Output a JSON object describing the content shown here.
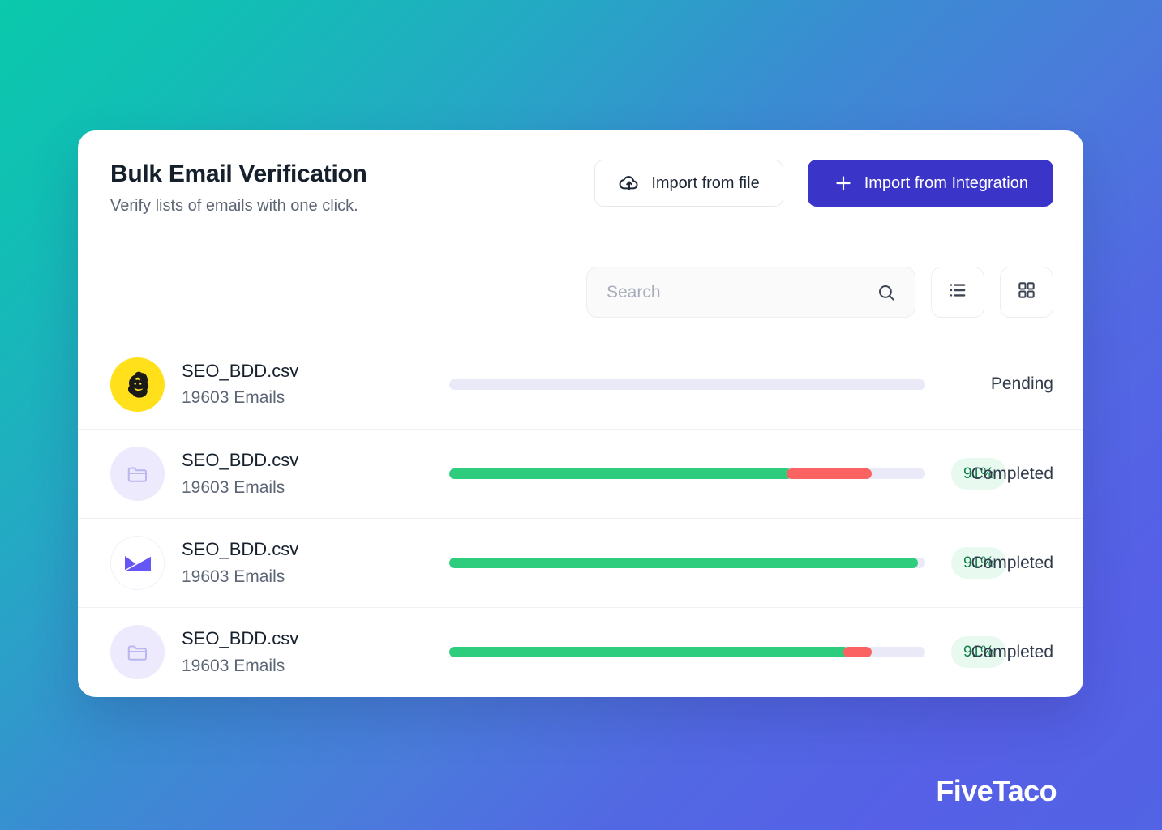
{
  "header": {
    "title": "Bulk Email Verification",
    "subtitle": "Verify lists of emails with one click.",
    "import_file_label": "Import from file",
    "import_integration_label": "Import from Integration"
  },
  "toolbar": {
    "search_placeholder": "Search",
    "search_value": "",
    "list_view_label": "List view",
    "grid_view_label": "Grid view"
  },
  "rows": [
    {
      "icon": "mailchimp-icon",
      "filename": "SEO_BDD.csv",
      "count": "19603 Emails",
      "valid_pct": 0,
      "invalid_pct": 0,
      "badge": "",
      "status": "Pending"
    },
    {
      "icon": "folder-icon",
      "filename": "SEO_BDD.csv",
      "count": "19603 Emails",
      "valid_pct": 72,
      "invalid_pct": 18,
      "badge": "91%",
      "status": "Completed"
    },
    {
      "icon": "mailjet-envelope-icon",
      "filename": "SEO_BDD.csv",
      "count": "19603 Emails",
      "valid_pct": 98.5,
      "invalid_pct": 0,
      "badge": "91%",
      "status": "Completed"
    },
    {
      "icon": "folder-icon",
      "filename": "SEO_BDD.csv",
      "count": "19603 Emails",
      "valid_pct": 84,
      "invalid_pct": 6,
      "badge": "91%",
      "status": "Completed"
    }
  ],
  "brand": {
    "name": "FiveTaco"
  },
  "colors": {
    "primary": "#3b34c9",
    "valid": "#2ecd7e",
    "invalid": "#fb6363",
    "track": "#eae9f7",
    "badge_bg": "#e8faf0",
    "badge_text": "#10814b",
    "mailchimp_yellow": "#ffe01b",
    "gradient_start": "#0ac9ac",
    "gradient_mid": "#3a8cd2",
    "gradient_end": "#5560e6"
  }
}
